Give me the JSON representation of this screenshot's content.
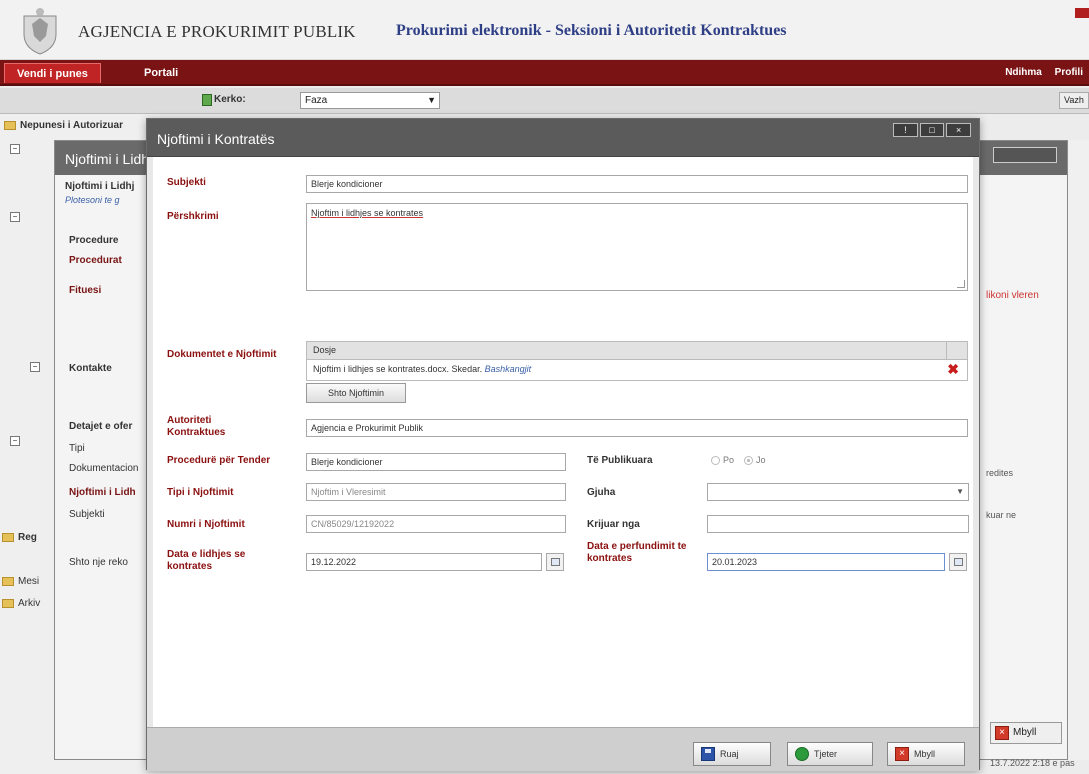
{
  "header": {
    "agency": "AGJENCIA E PROKURIMIT PUBLIK",
    "section": "Prokurimi elektronik - Seksioni i Autoritetit Kontraktues"
  },
  "nav": {
    "tabs": [
      "Vendi i punes",
      "Portali"
    ],
    "right": [
      "Ndihma",
      "Profili"
    ]
  },
  "toolbar": {
    "search_label": "Kerko:",
    "faza_value": "Faza",
    "vazh": "Vazh"
  },
  "tree": {
    "items": [
      "Nepunesi i Autorizuar",
      "Reg",
      "Mesi",
      "Arkiv"
    ]
  },
  "bg_dialog": {
    "title": "Njoftimi i Lidh",
    "subtitle": "Njoftimi i Lidhj",
    "hint": "Plotesoni te g",
    "labels": [
      "Procedure",
      "Procedurat",
      "Fituesi",
      "Kontakte",
      "Detajet e ofer",
      "Tipi",
      "Dokumentacion",
      "Njoftimi i Lidh",
      "Subjekti",
      "Shto nje reko"
    ],
    "right_texts": [
      "likoni vleren",
      "redites",
      "kuar ne"
    ],
    "mbyll": "Mbyll",
    "footer_date": "13.7.2022 2:18 e pas"
  },
  "modal": {
    "title": "Njoftimi i Kontratës",
    "fields": {
      "subjekti_label": "Subjekti",
      "subjekti_value": "Blerje kondicioner",
      "pershkrimi_label": "Përshkrimi",
      "pershkrimi_value": "Njoftim i lidhjes se kontrates",
      "dokumentet_label": "Dokumentet e Njoftimit",
      "docs_header": "Dosje",
      "docs_row": "Njoftim i lidhjes se kontrates.docx. Skedar.",
      "docs_link": "Bashkangjit",
      "shto_label": "Shto Njoftimin",
      "autoriteti_label": "Autoriteti Kontraktues",
      "autoriteti_value": "Agjencia e Prokurimit Publik",
      "procedure_label": "Procedurë për Tender",
      "procedure_value": "Blerje kondicioner",
      "tipi_label": "Tipi i Njoftimit",
      "tipi_value": "Njoftim i Vleresimit",
      "numri_label": "Numri i Njoftimit",
      "numri_value": "CN/85029/12192022",
      "data_lidhjes_label": "Data e lidhjes se kontrates",
      "data_lidhjes_value": "19.12.2022",
      "publikuara_label": "Të Publikuara",
      "po_label": "Po",
      "jo_label": "Jo",
      "gjuha_label": "Gjuha",
      "krijuar_label": "Krijuar nga",
      "data_perf_label": "Data e perfundimit te kontrates",
      "data_perf_value": "20.01.2023"
    },
    "buttons": {
      "save": "Ruaj",
      "next": "Tjeter",
      "close": "Mbyll"
    }
  },
  "colors": {
    "nav_bg": "#7a1414",
    "label_red": "#8b1010",
    "titlebar": "#5b5b5b"
  }
}
